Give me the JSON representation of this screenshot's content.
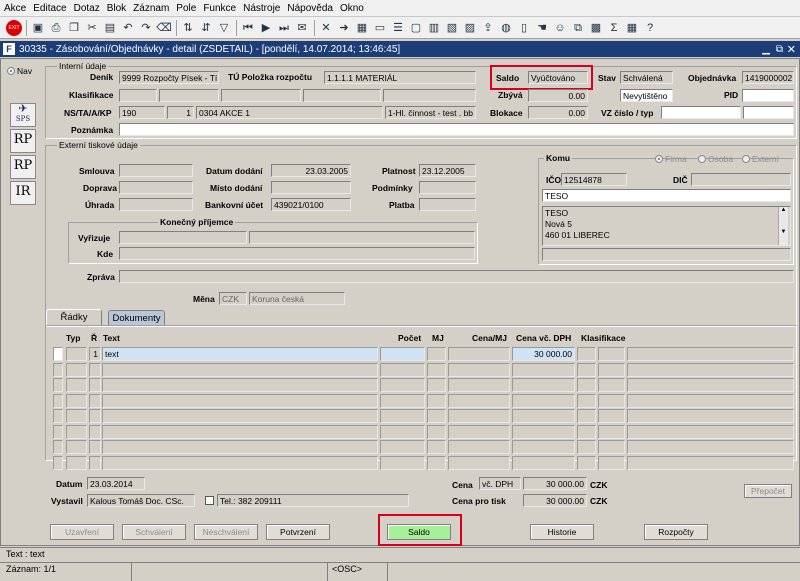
{
  "menu": [
    "Akce",
    "Editace",
    "Dotaz",
    "Blok",
    "Záznam",
    "Pole",
    "Funkce",
    "Nástroje",
    "Nápověda",
    "Okno"
  ],
  "window": {
    "title": "30335 - Zásobování/Objednávky - detail (ZSDETAIL) - [pondělí, 14.07.2014; 13:46:45]"
  },
  "nav": {
    "label": "Nav"
  },
  "side": {
    "sps": "SPS",
    "rp1": "RP",
    "rp2": "RP",
    "ir": "IR"
  },
  "internal": {
    "group_label": "Interní údaje",
    "denik_label": "Deník",
    "denik_value": "9999 Rozpočty Písek - Tí",
    "tu_label": "TÚ Položka rozpočtu",
    "tu_value": "1.1.1.1 MATERIÁL",
    "saldo_label": "Saldo",
    "saldo_value": "Vyúčtováno",
    "stav_label": "Stav",
    "stav_value": "Schválená",
    "objednavka_label": "Objednávka",
    "objednavka_value": "1419000002",
    "klasifikace_label": "Klasifikace",
    "zbyva_label": "Zbývá",
    "zbyva_value": "0.00",
    "nevytisteno": "Nevytištěno",
    "pid_label": "PID",
    "ns_label": "NS/TA/A/KP",
    "ns_value": "190",
    "ta_value": "1",
    "a_value": "0304 AKCE 1",
    "kp_value": "1-Hl. činnost - test . bb",
    "blokace_label": "Blokace",
    "blokace_value": "0.00",
    "vz_label": "VZ číslo / typ",
    "poznamka_label": "Poznámka"
  },
  "external": {
    "group_label": "Externí tiskové údaje",
    "smlouva_label": "Smlouva",
    "doprava_label": "Doprava",
    "uhrada_label": "Úhrada",
    "datum_dodani_label": "Datum dodání",
    "datum_dodani_value": "23.03.2005",
    "misto_dodani_label": "Místo dodání",
    "bankovni_label": "Bankovní účet",
    "bankovni_value": "439021/0100",
    "platnost_label": "Platnost",
    "platnost_value": "23.12.2005",
    "podminky_label": "Podmínky",
    "platba_label": "Platba",
    "komu_label": "Komu",
    "firma": "Firma",
    "osoba": "Osoba",
    "externi": "Externí",
    "ico_label": "IČO",
    "ico_value": "12514878",
    "dic_label": "DIČ",
    "komu_name": "TESO",
    "addr1": "TESO",
    "addr2": "Nová 5",
    "addr3": "460 01  LIBEREC",
    "konecny_label": "Konečný příjemce",
    "vyrizuje_label": "Vyřizuje",
    "kde_label": "Kde",
    "zprava_label": "Zpráva",
    "mena_label": "Měna",
    "mena_code": "CZK",
    "mena_name": "Koruna česká"
  },
  "tabs": {
    "radky": "Řádky",
    "dokumenty": "Dokumenty"
  },
  "grid": {
    "headers": {
      "typ": "Typ",
      "r": "Ř",
      "text": "Text",
      "pocet": "Počet",
      "mj": "MJ",
      "cena_mj": "Cena/MJ",
      "cena_dph": "Cena vč. DPH",
      "klasifikace": "Klasifikace"
    },
    "row1": {
      "r": "1",
      "text": "text",
      "cena_dph": "30 000.00"
    }
  },
  "bottom": {
    "datum_label": "Datum",
    "datum_value": "23.03.2014",
    "vystavil_label": "Vystavil",
    "vystavil_value": "Kalous Tomáš Doc. CSc.",
    "tel_value": "Tel.: 382 209111",
    "cena_label": "Cena",
    "cena_type": "vč. DPH",
    "cena_value": "30 000.00",
    "cena_currency": "CZK",
    "cena_tisk_label": "Cena pro tisk",
    "cena_tisk_value": "30 000.00",
    "cena_tisk_currency": "CZK",
    "prepocet": "Přepočet"
  },
  "buttons": {
    "uzavreni": "Uzavření",
    "schvaleni": "Schválení",
    "neschvaleni": "Neschválení",
    "potvrzeni": "Potvrzení",
    "saldo": "Saldo",
    "historie": "Historie",
    "rozpocty": "Rozpočty"
  },
  "status": {
    "line1": "Text : text",
    "zaznam": "Záznam: 1/1",
    "osc": "<OSC>"
  },
  "colors": {
    "title_bar": "#1c3e78",
    "highlight": "#d6001c",
    "saldo_button": "#a6f09a",
    "selected_row": "#cfe3f5"
  }
}
